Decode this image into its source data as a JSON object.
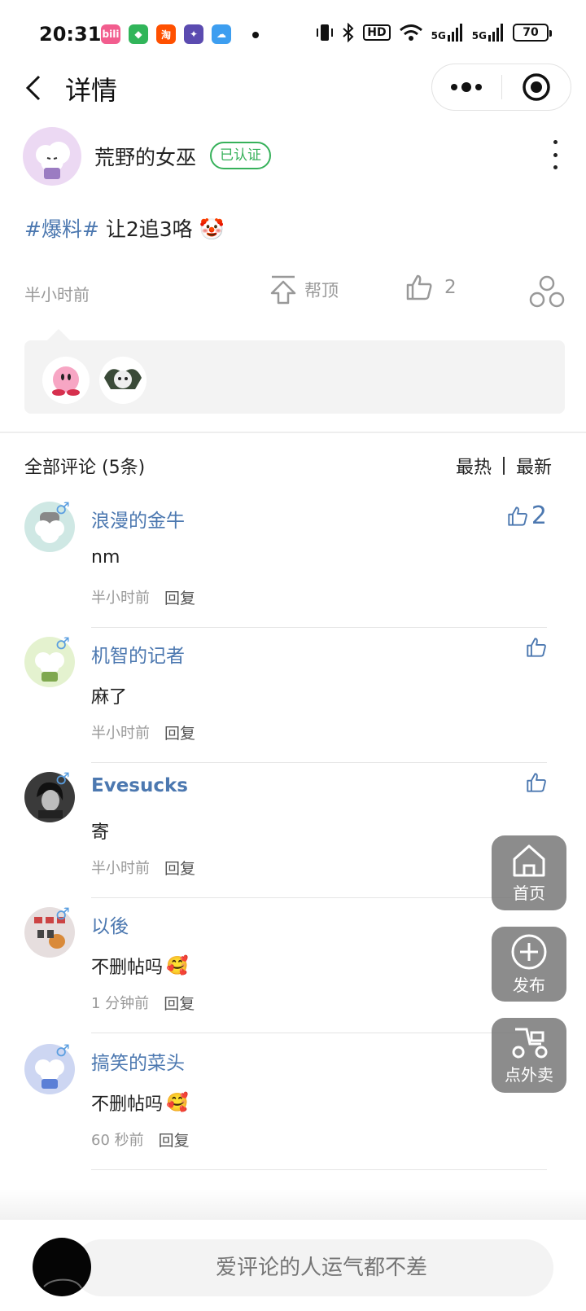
{
  "status_bar": {
    "time": "20:31",
    "apps": [
      {
        "name": "bilibili",
        "label": "bili",
        "color": "#f25d8e"
      },
      {
        "name": "security",
        "label": "◆",
        "color": "#31b55a"
      },
      {
        "name": "taobao",
        "label": "淘",
        "color": "#ff5000"
      },
      {
        "name": "game",
        "label": "✦",
        "color": "#5b4bb0"
      },
      {
        "name": "weather",
        "label": "☁",
        "color": "#3d9ef0"
      }
    ],
    "hd": "HD",
    "signal1": "5G",
    "signal2": "5G",
    "battery": "70"
  },
  "nav": {
    "title": "详情"
  },
  "post": {
    "author": "荒野的女巫",
    "verified": "已认证",
    "tag": "#爆料#",
    "text": "让2追3咯",
    "emoji": "🤡",
    "time": "半小时前",
    "boost_label": "帮顶",
    "like_count": "2"
  },
  "comments_header": {
    "title": "全部评论 (5条)",
    "sort_hot": "最热",
    "sort_new": "最新"
  },
  "comments": [
    {
      "name": "浪漫的金牛",
      "text": "nm",
      "time": "半小时前",
      "reply": "回复",
      "likes": "2",
      "gender": "♂",
      "avatar_color": "#cfe8e4"
    },
    {
      "name": "机智的记者",
      "text": "麻了",
      "time": "半小时前",
      "reply": "回复",
      "likes": "",
      "gender": "♂",
      "avatar_color": "#e4f2cf"
    },
    {
      "name": "Evesucks",
      "text": "寄",
      "time": "半小时前",
      "reply": "回复",
      "likes": "",
      "gender": "♂",
      "avatar_color": "#3a3a3a"
    },
    {
      "name": "以後",
      "text": "不删帖吗",
      "emoji": "🥰",
      "time": "1 分钟前",
      "reply": "回复",
      "likes": "",
      "gender": "♂",
      "avatar_color": "#e6dede"
    },
    {
      "name": "搞笑的菜头",
      "text": "不删帖吗",
      "emoji": "🥰",
      "time": "60 秒前",
      "reply": "回复",
      "likes": "",
      "gender": "♂",
      "avatar_color": "#cdd6f2"
    }
  ],
  "fabs": {
    "home": "首页",
    "publish": "发布",
    "takeout": "点外卖"
  },
  "bottom": {
    "placeholder": "爱评论的人运气都不差"
  }
}
